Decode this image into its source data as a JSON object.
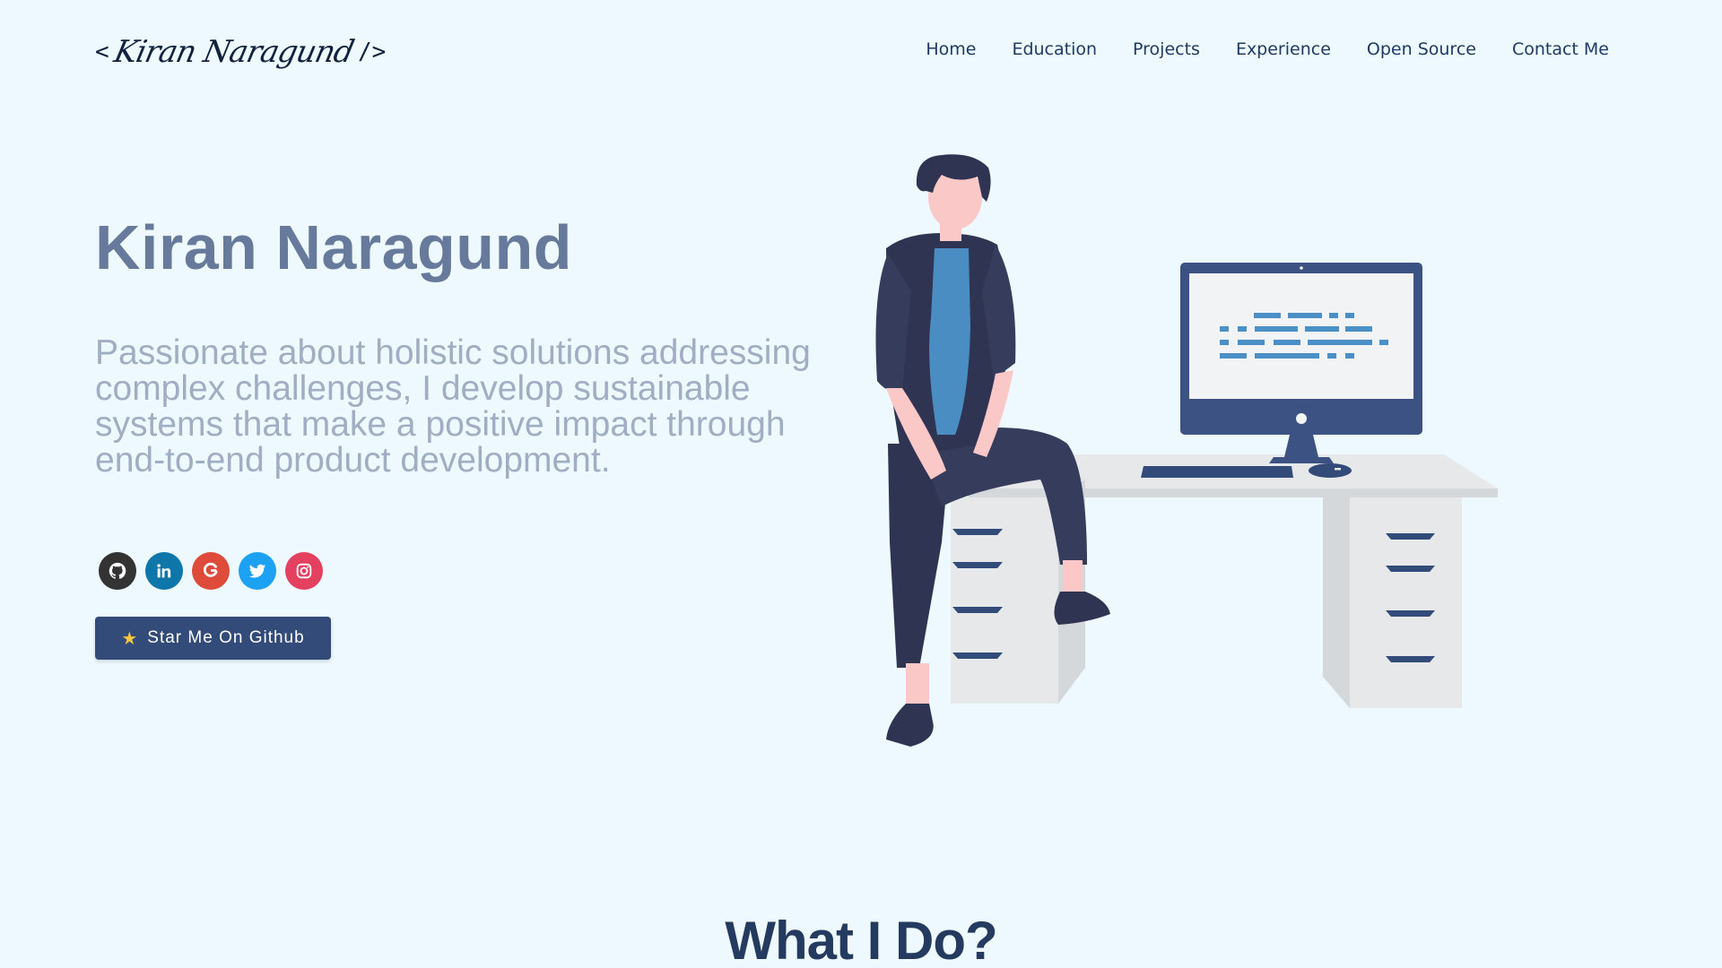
{
  "header": {
    "logo": {
      "open": "<",
      "signature": "Kiran Naragund",
      "close": "/>"
    },
    "nav": [
      "Home",
      "Education",
      "Projects",
      "Experience",
      "Open Source",
      "Contact Me"
    ]
  },
  "hero": {
    "name": "Kiran Naragund",
    "subtitle": "Passionate about holistic solutions addressing complex challenges, I develop sustainable systems that make a positive impact through end-to-end product development.",
    "socials": [
      {
        "icon": "github-icon",
        "color": "#333333"
      },
      {
        "icon": "linkedin-icon",
        "color": "#0e76a8"
      },
      {
        "icon": "google-icon",
        "color": "#df4b3b"
      },
      {
        "icon": "twitter-icon",
        "color": "#1da1f2"
      },
      {
        "icon": "instagram-icon",
        "color": "#e4405f"
      }
    ],
    "star_button": {
      "icon": "star-icon",
      "label": "Star Me On Github"
    }
  },
  "section": {
    "title": "What I Do?"
  },
  "colors": {
    "background": "#edf9fe",
    "accent": "#324b78",
    "name": "#677a9b",
    "subtitle": "#a0adc2"
  }
}
